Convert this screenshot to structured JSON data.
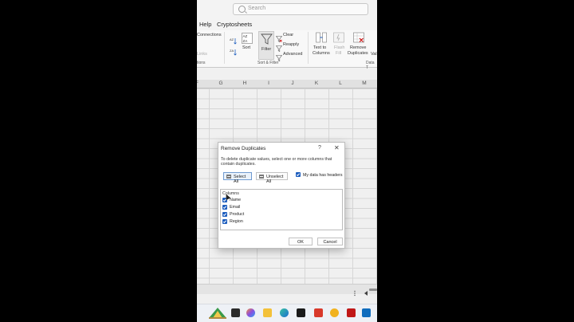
{
  "search": {
    "placeholder": "Search"
  },
  "menu": [
    "Help",
    "Cryptosheets"
  ],
  "ribbon": {
    "connections": "Connections",
    "links": "Links",
    "connections_group": "tions",
    "sort": "Sort",
    "sort_az": "A Z",
    "sort_za": "Z A",
    "filter": "Filter",
    "clear": "Clear",
    "reapply": "Reapply",
    "advanced": "Advanced",
    "sort_filter_group": "Sort & Filter",
    "text_to_columns_1": "Text to",
    "text_to_columns_2": "Columns",
    "flash_fill_1": "Flash",
    "flash_fill_2": "Fill",
    "remove_dup_1": "Remove",
    "remove_dup_2": "Duplicates",
    "data_tools_group": "Data T",
    "valid": "Val"
  },
  "columns": [
    "F",
    "G",
    "H",
    "I",
    "J",
    "K",
    "L",
    "M"
  ],
  "dialog": {
    "title": "Remove Duplicates",
    "help": "?",
    "close": "✕",
    "description": "To delete duplicate values, select one or more columns that contain duplicates.",
    "select_all": "Select All",
    "unselect_all": "Unselect All",
    "headers_checkbox": "My data has headers",
    "headers_checked": true,
    "columns_title": "Columns",
    "column_items": [
      {
        "name": "Name",
        "checked": true
      },
      {
        "name": "Email",
        "checked": true
      },
      {
        "name": "Product",
        "checked": true
      },
      {
        "name": "Region",
        "checked": true
      }
    ],
    "ok": "OK",
    "cancel": "Cancel"
  },
  "taskbar_icons": [
    "start-icon",
    "task-view-icon",
    "copilot-icon",
    "file-explorer-icon",
    "edge-icon",
    "store-icon",
    "office-icon",
    "app-red-icon",
    "app-yellow-icon",
    "mcafee-icon",
    "outlook-icon"
  ],
  "colors": {
    "accent": "#1f5fbf",
    "excel_green": "#217346"
  }
}
